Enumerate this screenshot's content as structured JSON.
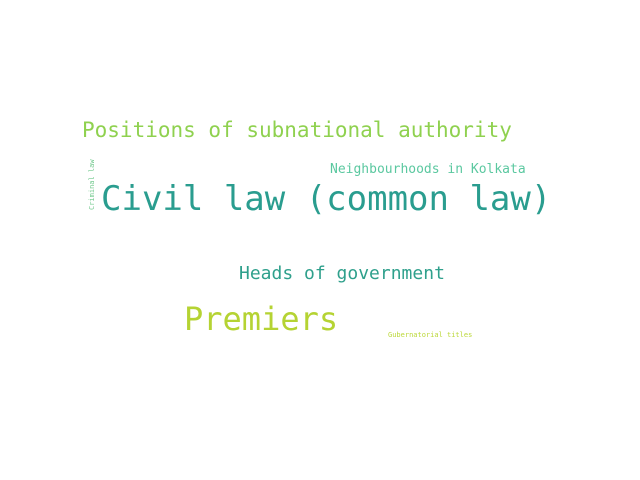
{
  "word_cloud": {
    "words": [
      {
        "key": "positions",
        "text": "Positions of subnational authority",
        "color": "#8fd14f"
      },
      {
        "key": "kolkata",
        "text": "Neighbourhoods in Kolkata",
        "color": "#5bc8a0"
      },
      {
        "key": "civil",
        "text": "Civil law (common law)",
        "color": "#2a9d8f"
      },
      {
        "key": "criminal",
        "text": "Criminal law",
        "color": "#72c98e",
        "orientation": "vertical"
      },
      {
        "key": "heads",
        "text": "Heads of government",
        "color": "#2fa08c"
      },
      {
        "key": "premiers",
        "text": "Premiers",
        "color": "#b5d333"
      },
      {
        "key": "gubernatorial",
        "text": "Gubernatorial titles",
        "color": "#bcd83a"
      }
    ]
  }
}
